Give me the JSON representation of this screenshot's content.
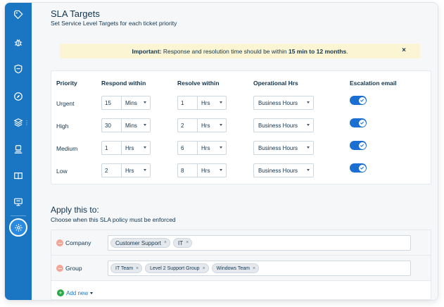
{
  "sidebar": {
    "icons": [
      "tag-icon",
      "bug-icon",
      "shield-icon",
      "compass-icon",
      "layers-icon",
      "person-icon",
      "book-icon",
      "monitor-icon"
    ],
    "active_icon": "gear-icon",
    "accent": "#1a75c2"
  },
  "page": {
    "title": "SLA Targets",
    "subtitle": "Set Service Level Targets for each ticket priority"
  },
  "banner": {
    "label": "Important:",
    "text_before": " Response and resolution time should be within ",
    "range": "15 min to 12 months",
    "text_after": ".",
    "close": "×"
  },
  "sla_table": {
    "headers": [
      "Priority",
      "Respond within",
      "Resolve within",
      "Operational Hrs",
      "Escalation email"
    ],
    "rows": [
      {
        "priority": "Urgent",
        "respond_value": "15",
        "respond_unit": "Mins",
        "resolve_value": "1",
        "resolve_unit": "Hrs",
        "hours": "Business Hours",
        "escalation": true
      },
      {
        "priority": "High",
        "respond_value": "30",
        "respond_unit": "Mins",
        "resolve_value": "2",
        "resolve_unit": "Hrs",
        "hours": "Business Hours",
        "escalation": true
      },
      {
        "priority": "Medium",
        "respond_value": "1",
        "respond_unit": "Hrs",
        "resolve_value": "6",
        "resolve_unit": "Hrs",
        "hours": "Business Hours",
        "escalation": true
      },
      {
        "priority": "Low",
        "respond_value": "2",
        "respond_unit": "Hrs",
        "resolve_value": "8",
        "resolve_unit": "Hrs",
        "hours": "Business Hours",
        "escalation": true
      }
    ]
  },
  "apply": {
    "title": "Apply this to:",
    "subtitle": "Choose when this SLA policy must be enforced",
    "rows": [
      {
        "label": "Company",
        "tags": [
          "Customer Support",
          "IT"
        ]
      },
      {
        "label": "Group",
        "tags": [
          "IT Team",
          "Level 2 Support Group",
          "Windows Team"
        ]
      }
    ],
    "add_new": "Add new"
  },
  "tag_remove": "×",
  "add_plus": "+"
}
